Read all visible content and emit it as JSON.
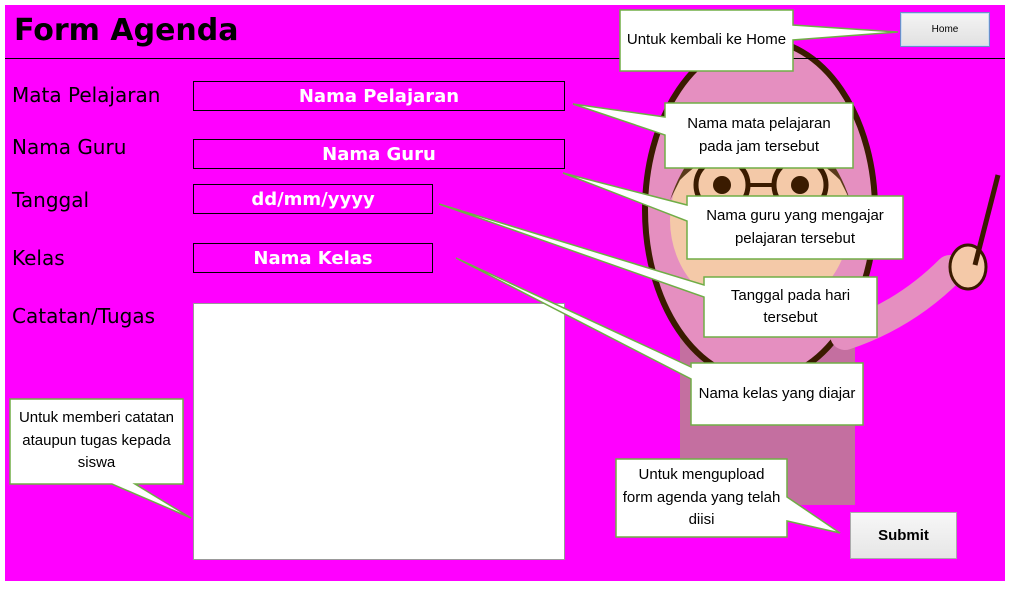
{
  "header": {
    "title": "Form Agenda",
    "home_label": "Home"
  },
  "form": {
    "labels": {
      "subject": "Mata Pelajaran",
      "teacher": "Nama Guru",
      "date": "Tanggal",
      "class": "Kelas",
      "notes": "Catatan/Tugas"
    },
    "fields": {
      "subject": "Nama Pelajaran",
      "teacher": "Nama Guru",
      "date": "dd/mm/yyyy",
      "class": "Nama Kelas",
      "notes": ""
    },
    "submit_label": "Submit"
  },
  "callouts": {
    "home": "Untuk kembali ke Home",
    "subject": "Nama mata pelajaran pada jam tersebut",
    "teacher": "Nama guru yang mengajar pelajaran tersebut",
    "date": "Tanggal pada hari tersebut",
    "class": "Nama kelas yang diajar",
    "notes": "Untuk memberi catatan ataupun tugas kepada siswa",
    "submit": "Untuk mengupload form agenda yang telah diisi"
  },
  "colors": {
    "background": "#ff00ff",
    "callout_border": "#70ad47",
    "field_text": "#ffffff"
  }
}
